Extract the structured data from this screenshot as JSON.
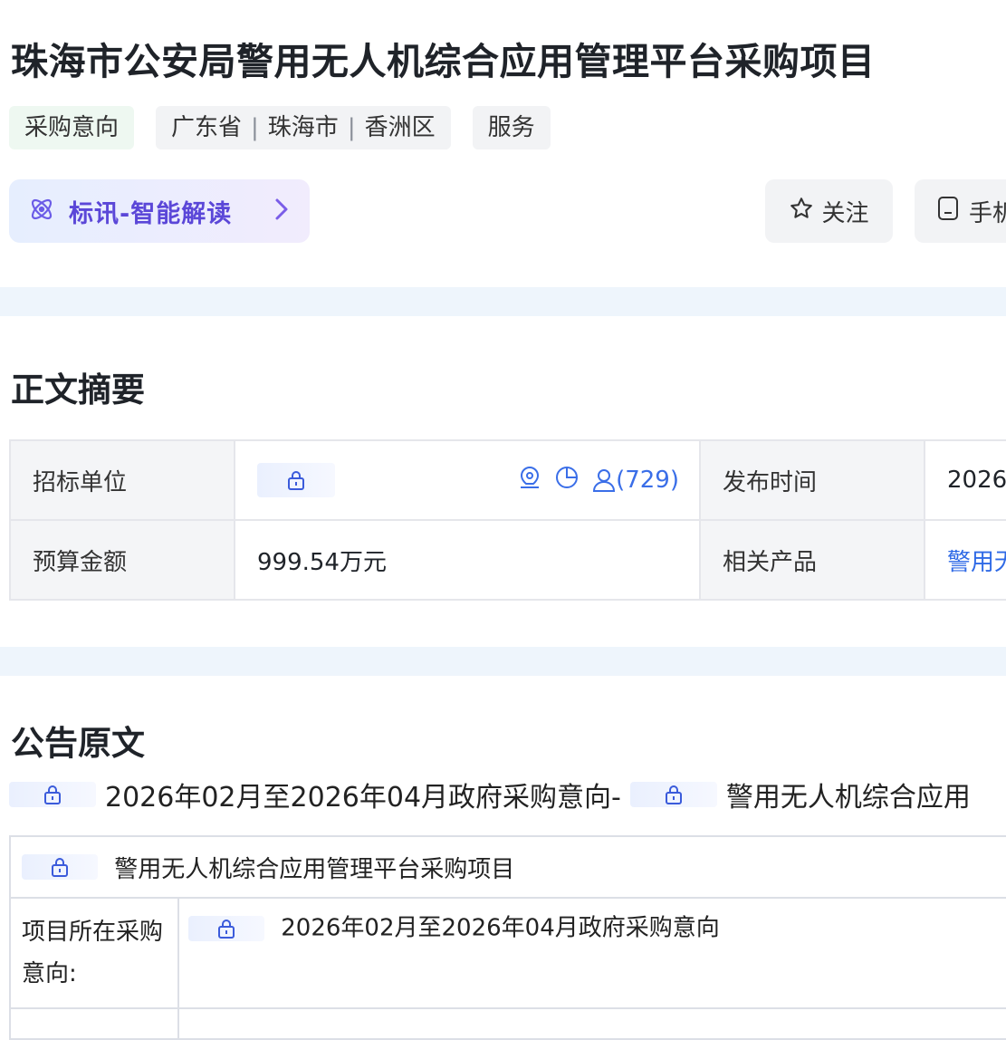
{
  "header": {
    "title": "珠海市公安局警用无人机综合应用管理平台采购项目",
    "tags": {
      "type": "采购意向",
      "province": "广东省",
      "city": "珠海市",
      "district": "香洲区",
      "category": "服务"
    },
    "ai_button": {
      "label": "标讯-智能解读"
    },
    "follow_button": {
      "label": "关注"
    },
    "phone_button": {
      "label": "手机"
    }
  },
  "summary": {
    "section_title": "正文摘要",
    "rows": [
      {
        "label": "招标单位",
        "contact_count": "(729)",
        "label2": "发布时间",
        "value2": "2026"
      },
      {
        "label": "预算金额",
        "value": "999.54万元",
        "label2": "相关产品",
        "value2": "警用无"
      }
    ]
  },
  "original": {
    "section_title": "公告原文",
    "notice_line": {
      "part1": "2026年02月至2026年04月政府采购意向-",
      "part2": "警用无人机综合应用"
    },
    "table": {
      "header": "警用无人机综合应用管理平台采购项目",
      "row1_label": "项目所在采购意向:",
      "row1_value": "2026年02月至2026年04月政府采购意向"
    }
  },
  "colors": {
    "accent": "#5b47d8",
    "link": "#2f6ae6",
    "band": "#eef5fc",
    "tag_green_bg": "#eef8f1"
  }
}
